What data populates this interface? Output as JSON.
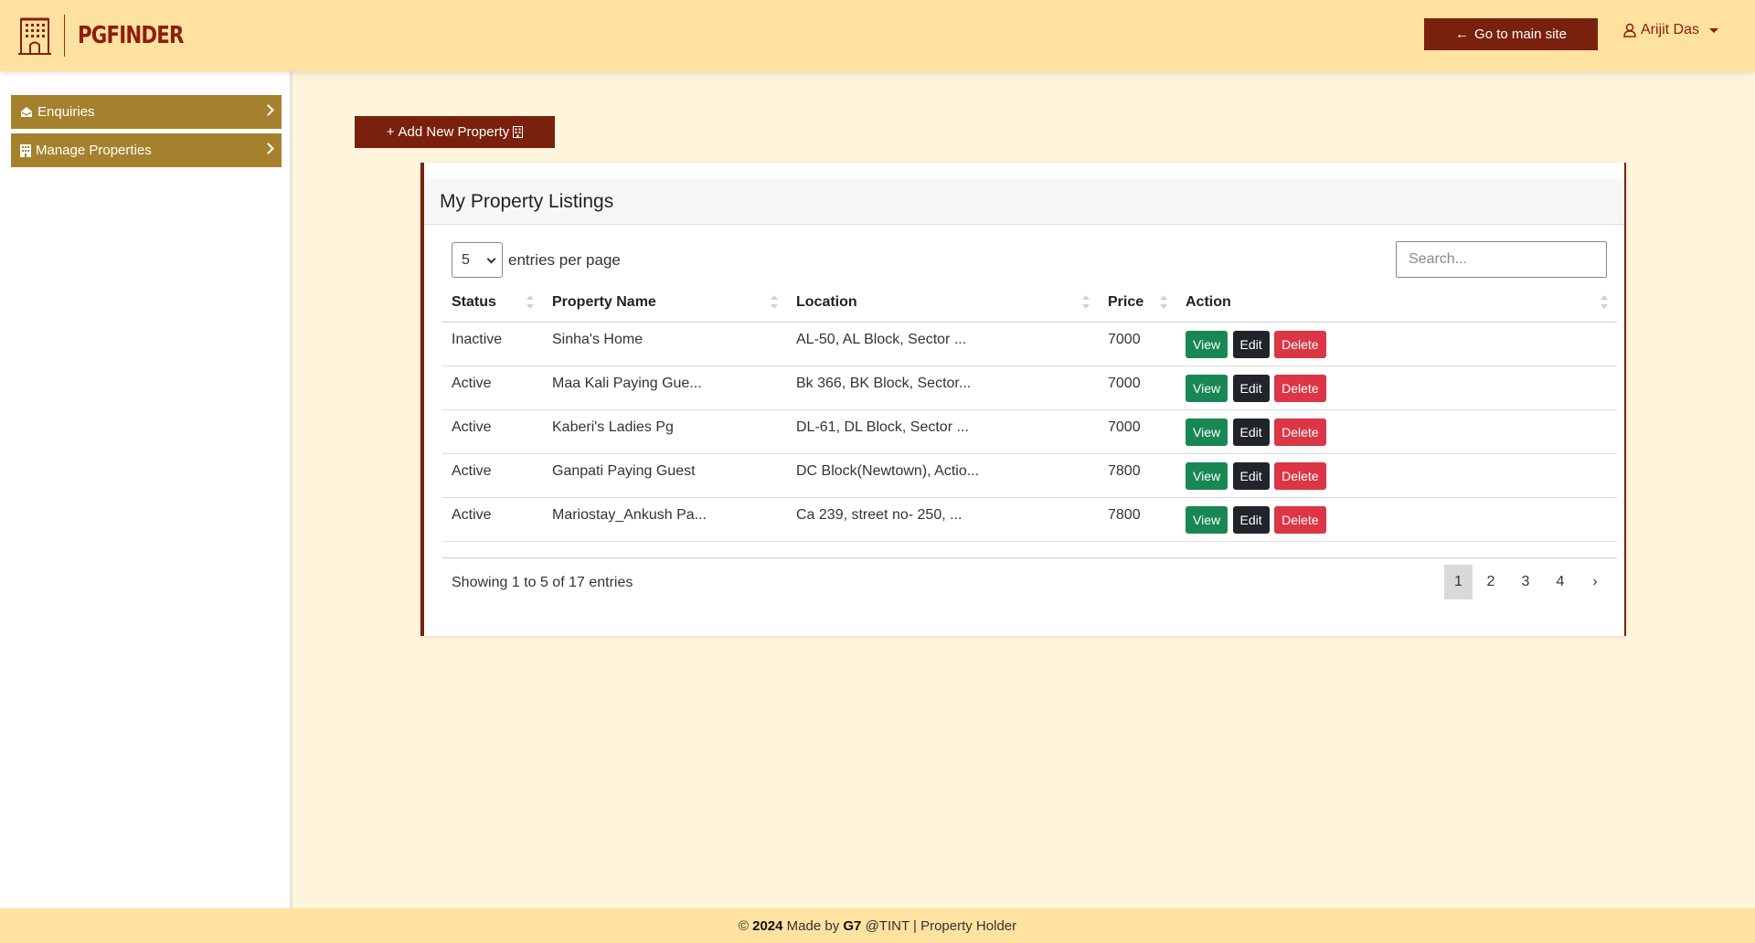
{
  "brand": {
    "name": "PGFINDER"
  },
  "header": {
    "main_site_label": "Go to main site",
    "user_name": "Arijit Das"
  },
  "sidebar": {
    "items": [
      {
        "label": "Enquiries",
        "icon": "envelope-open-icon"
      },
      {
        "label": "Manage Properties",
        "icon": "building-icon"
      }
    ]
  },
  "main": {
    "add_property_label": "Add New Property",
    "card_title": "My Property Listings",
    "per_page_value": "5",
    "per_page_label": "entries per page",
    "search_placeholder": "Search...",
    "columns": [
      "Status",
      "Property Name",
      "Location",
      "Price",
      "Action"
    ],
    "rows": [
      {
        "status": "Inactive",
        "name": "Sinha's Home",
        "location": "AL-50, AL Block, Sector ...",
        "price": "7000"
      },
      {
        "status": "Active",
        "name": "Maa Kali Paying Gue...",
        "location": "Bk 366, BK Block, Sector...",
        "price": "7000"
      },
      {
        "status": "Active",
        "name": "Kaberi's Ladies Pg",
        "location": "DL-61, DL Block, Sector ...",
        "price": "7000"
      },
      {
        "status": "Active",
        "name": "Ganpati Paying Guest",
        "location": "DC Block(Newtown), Actio...",
        "price": "7800"
      },
      {
        "status": "Active",
        "name": "Mariostay_Ankush Pa...",
        "location": "Ca 239, street no- 250, ...",
        "price": "7800"
      }
    ],
    "action_labels": {
      "view": "View",
      "edit": "Edit",
      "delete": "Delete"
    },
    "showing_text": "Showing 1 to 5 of 17 entries",
    "pages": [
      "1",
      "2",
      "3",
      "4",
      "›"
    ],
    "active_page": "1"
  },
  "footer": {
    "copyright": "©",
    "year": "2024",
    "made_by": "Made by",
    "team": "G7",
    "suffix": "@TINT | Property Holder"
  }
}
